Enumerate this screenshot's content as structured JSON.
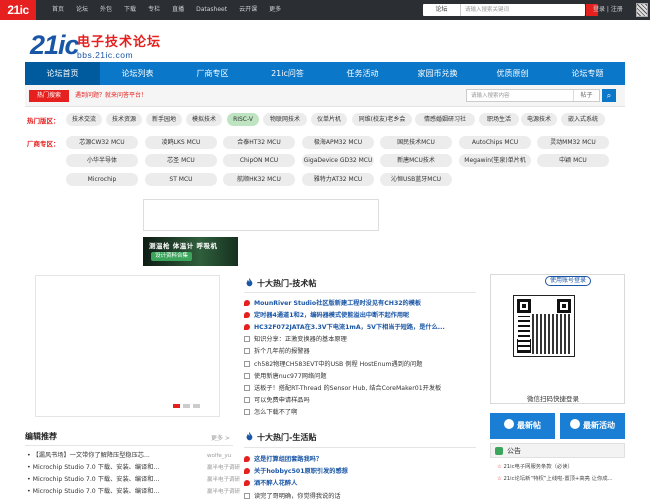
{
  "topbar": {
    "logo": "21ic",
    "nav": [
      "首页",
      "论坛",
      "外包",
      "下载",
      "专栏",
      "直播",
      "Datasheet",
      "云开课",
      "更多"
    ],
    "search_select": "论坛",
    "search_placeholder": "请输入搜索关键词",
    "auth": "登录 | 注册"
  },
  "header": {
    "logo_num": "21ic",
    "logo_cn": "电子技术论坛",
    "logo_url": "bbs.21ic.com"
  },
  "mainnav": [
    "论坛首页",
    "论坛列表",
    "厂商专区",
    "21ic问答",
    "任务活动",
    "家园币兑换",
    "优质原创",
    "论坛专题"
  ],
  "hotbar": {
    "label": "热门搜索",
    "link": "遇到问题？就来问答平台！",
    "search_placeholder": "请输入搜索内容",
    "search_select": "帖子"
  },
  "hot_sections": {
    "label": "热门版区：",
    "tags": [
      "技术交流",
      "技术资源",
      "新手园地",
      "模拟技术",
      "RISC-V",
      "物联网技术",
      "仪单片机",
      "同维(校友)老乡会",
      "情感婚姻研习社",
      "职场生活",
      "电源技术",
      "嵌入式系统"
    ]
  },
  "vendor_sections": {
    "label": "厂商专区：",
    "rows": [
      [
        "芯源CW32 MCU",
        "凌鸥LKS MCU",
        "合泰HT32 MCU",
        "极海APM32 MCU",
        "国民技术MCU",
        "AutoChips MCU",
        "灵动MM32 MCU"
      ],
      [
        "小华半导体",
        "芯圣 MCU",
        "ChipON MCU",
        "GigaDevice GD32 MCU",
        "新唐MCU技术",
        "Megawin(笙泉)单片机",
        "中颖 MCU"
      ],
      [
        "Microchip",
        "ST MCU",
        "航顺HK32 MCU",
        "雅特力AT32 MCU",
        "沁恒USB蓝牙MCU"
      ]
    ]
  },
  "banner2": {
    "line1": "测温枪 体温计 呼吸机",
    "line2": "设计资料合集"
  },
  "hot_tech": {
    "title": "十大热门-技术帖",
    "posts": [
      {
        "text": "MounRiver Studio社区版新建工程时没见有CH32的模板",
        "top": true
      },
      {
        "text": "定时器4通道1和2，编码器模式使能溢出中断不起作用呢",
        "top": true
      },
      {
        "text": "HC32F072JATA在3.3V下电流1mA，5V下相当于短路，是什么...",
        "top": true
      },
      {
        "text": "知识分享：正激变换器的基本原理",
        "top": false
      },
      {
        "text": "拆个几年前的报警器",
        "top": false
      },
      {
        "text": "ch582物理CH583EVT中的USB 例程 HostEnum遇到的问题",
        "top": false
      },
      {
        "text": "使用新唐nuc977网络问题",
        "top": false
      },
      {
        "text": "送板子！搭配RT-Thread 的Sensor Hub, 结合CoreMaker01开发板",
        "top": false
      },
      {
        "text": "可以免费申请样品吗",
        "top": false
      },
      {
        "text": "怎么下载不了啊",
        "top": false
      }
    ]
  },
  "hot_life": {
    "title": "十大热门-生活贴",
    "posts": [
      {
        "text": "这是打算组团套路我吗？",
        "top": true
      },
      {
        "text": "关于hobbyc501原职引发的感想",
        "top": true
      },
      {
        "text": "酒不醉人花醉人",
        "top": true
      },
      {
        "text": "读完了哥明确，你觉得我说的话",
        "top": false
      }
    ]
  },
  "editor": {
    "title": "编辑推荐",
    "more": "更多 >",
    "rows": [
      {
        "text": "【漏风书场】一文带你了解降压型稳压芯...",
        "author": "wolfe_yu"
      },
      {
        "text": "Microchip Studio 7.0 下载、安装、编译和...",
        "author": "羸半电子调研"
      },
      {
        "text": "Microchip Studio 7.0 下载、安装、编译和...",
        "author": "羸半电子调研"
      },
      {
        "text": "Microchip Studio 7.0 下载、安装、编译和...",
        "author": "羸半电子调研"
      }
    ]
  },
  "right": {
    "follow_title": "使用账号登录",
    "qr_caption": "微信扫码快捷登录",
    "btn_post": "最新帖",
    "btn_activity": "最新活动",
    "notice_title": "公告",
    "notices": [
      "21ic电子网服务条款（必读）",
      "21ic论坛新“特权”上线啦-置顶+高亮 让你成..."
    ]
  }
}
